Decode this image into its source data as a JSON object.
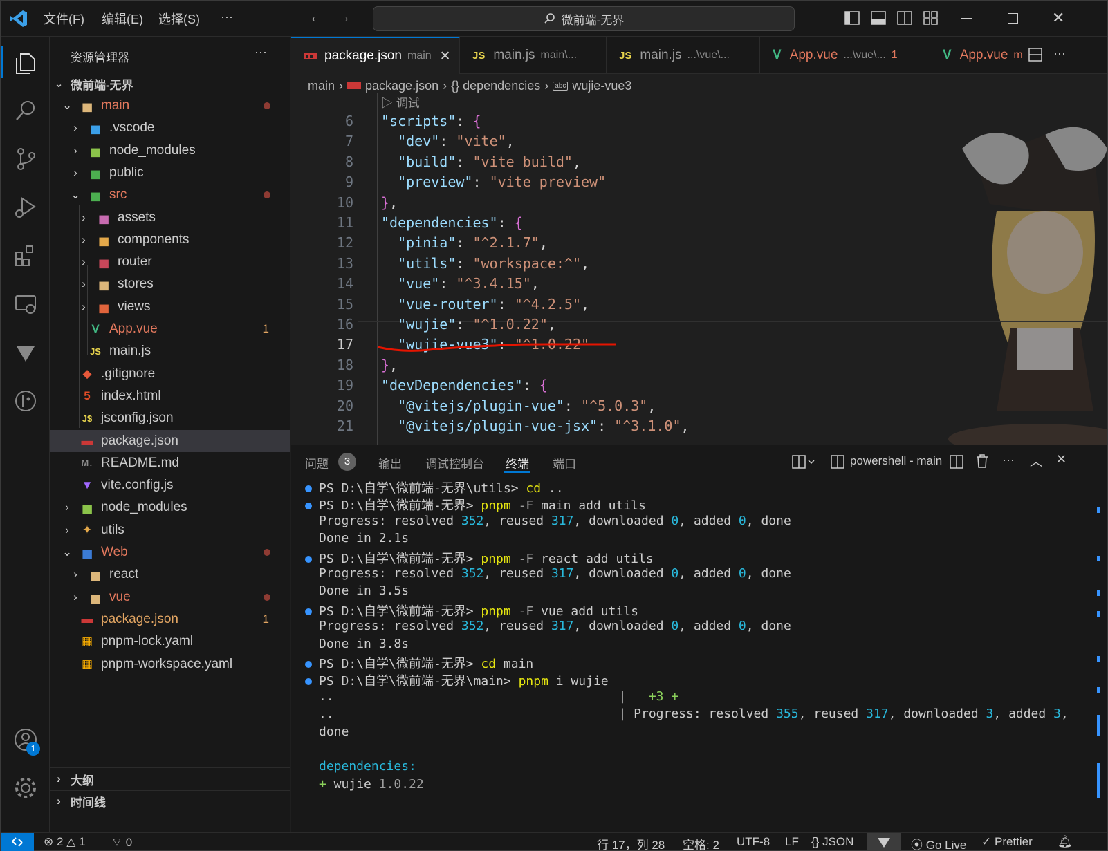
{
  "titlebar": {
    "menu": [
      "文件(F)",
      "编辑(E)",
      "选择(S)",
      "···"
    ],
    "search_text": "微前端-无界"
  },
  "sidebar": {
    "title": "资源管理器",
    "more": "···",
    "root": "微前端-无界",
    "items": [
      {
        "label": "main",
        "color": "#e2785d",
        "icon": "folder-open-icon",
        "badge": "dot"
      },
      {
        "label": ".vscode",
        "color": "#cccccc",
        "icon": "vscode-folder-icon"
      },
      {
        "label": "node_modules",
        "color": "#cccccc",
        "icon": "node-folder-icon"
      },
      {
        "label": "public",
        "color": "#cccccc",
        "icon": "public-folder-icon"
      },
      {
        "label": "src",
        "color": "#e2785d",
        "icon": "src-folder-icon",
        "badge": "dot"
      },
      {
        "label": "assets",
        "color": "#cccccc",
        "icon": "assets-folder-icon"
      },
      {
        "label": "components",
        "color": "#cccccc",
        "icon": "components-folder-icon"
      },
      {
        "label": "router",
        "color": "#cccccc",
        "icon": "router-folder-icon"
      },
      {
        "label": "stores",
        "color": "#cccccc",
        "icon": "folder-icon"
      },
      {
        "label": "views",
        "color": "#cccccc",
        "icon": "views-folder-icon"
      },
      {
        "label": "App.vue",
        "color": "#e2785d",
        "icon": "vue-file-icon",
        "count": "1"
      },
      {
        "label": "main.js",
        "color": "#cccccc",
        "icon": "js-file-icon"
      },
      {
        "label": ".gitignore",
        "color": "#cccccc",
        "icon": "git-file-icon"
      },
      {
        "label": "index.html",
        "color": "#cccccc",
        "icon": "html-file-icon"
      },
      {
        "label": "jsconfig.json",
        "color": "#cccccc",
        "icon": "jsconfig-file-icon"
      },
      {
        "label": "package.json",
        "color": "#cccccc",
        "icon": "npm-file-icon"
      },
      {
        "label": "README.md",
        "color": "#cccccc",
        "icon": "markdown-file-icon"
      },
      {
        "label": "vite.config.js",
        "color": "#cccccc",
        "icon": "vite-file-icon"
      },
      {
        "label": "node_modules",
        "color": "#cccccc",
        "icon": "node-folder-icon"
      },
      {
        "label": "utils",
        "color": "#cccccc",
        "icon": "utils-folder-icon"
      },
      {
        "label": "Web",
        "color": "#e2785d",
        "icon": "web-folder-icon",
        "badge": "dot"
      },
      {
        "label": "react",
        "color": "#cccccc",
        "icon": "folder-icon"
      },
      {
        "label": "vue",
        "color": "#e2785d",
        "icon": "folder-icon",
        "badge": "dot"
      },
      {
        "label": "package.json",
        "color": "#e3a663",
        "icon": "npm-file-icon",
        "count": "1"
      },
      {
        "label": "pnpm-lock.yaml",
        "color": "#cccccc",
        "icon": "pnpm-file-icon"
      },
      {
        "label": "pnpm-workspace.yaml",
        "color": "#cccccc",
        "icon": "pnpm-file-icon"
      }
    ],
    "outline": "大纲",
    "timeline": "时间线"
  },
  "tabs": [
    {
      "label": "package.json",
      "desc": "main",
      "active": true
    },
    {
      "label": "main.js",
      "desc": "main\\..."
    },
    {
      "label": "main.js",
      "desc": "...\\vue\\..."
    },
    {
      "label": "App.vue",
      "desc": "...\\vue\\...",
      "count": "1"
    },
    {
      "label": "App.vue",
      "desc": "m"
    }
  ],
  "breadcrumb": [
    "main",
    "package.json",
    "{} dependencies",
    "wujie-vue3"
  ],
  "codelens": "调试",
  "code_lines": [
    {
      "n": "6",
      "t": [
        [
          "k",
          "\"scripts\""
        ],
        [
          "p",
          ": "
        ],
        [
          "b1",
          "{"
        ]
      ]
    },
    {
      "n": "7",
      "t": [
        [
          "p",
          "  "
        ],
        [
          "k",
          "\"dev\""
        ],
        [
          "p",
          ": "
        ],
        [
          "s",
          "\"vite\""
        ],
        [
          "p",
          ","
        ]
      ]
    },
    {
      "n": "8",
      "t": [
        [
          "p",
          "  "
        ],
        [
          "k",
          "\"build\""
        ],
        [
          "p",
          ": "
        ],
        [
          "s",
          "\"vite build\""
        ],
        [
          "p",
          ","
        ]
      ]
    },
    {
      "n": "9",
      "t": [
        [
          "p",
          "  "
        ],
        [
          "k",
          "\"preview\""
        ],
        [
          "p",
          ": "
        ],
        [
          "s",
          "\"vite preview\""
        ]
      ]
    },
    {
      "n": "10",
      "t": [
        [
          "b1",
          "}"
        ],
        [
          "p",
          ","
        ]
      ]
    },
    {
      "n": "11",
      "t": [
        [
          "k",
          "\"dependencies\""
        ],
        [
          "p",
          ": "
        ],
        [
          "b1",
          "{"
        ]
      ]
    },
    {
      "n": "12",
      "t": [
        [
          "p",
          "  "
        ],
        [
          "k",
          "\"pinia\""
        ],
        [
          "p",
          ": "
        ],
        [
          "s",
          "\"^2.1.7\""
        ],
        [
          "p",
          ","
        ]
      ]
    },
    {
      "n": "13",
      "t": [
        [
          "p",
          "  "
        ],
        [
          "k",
          "\"utils\""
        ],
        [
          "p",
          ": "
        ],
        [
          "s",
          "\"workspace:^\""
        ],
        [
          "p",
          ","
        ]
      ]
    },
    {
      "n": "14",
      "t": [
        [
          "p",
          "  "
        ],
        [
          "k",
          "\"vue\""
        ],
        [
          "p",
          ": "
        ],
        [
          "s",
          "\"^3.4.15\""
        ],
        [
          "p",
          ","
        ]
      ]
    },
    {
      "n": "15",
      "t": [
        [
          "p",
          "  "
        ],
        [
          "k",
          "\"vue-router\""
        ],
        [
          "p",
          ": "
        ],
        [
          "s",
          "\"^4.2.5\""
        ],
        [
          "p",
          ","
        ]
      ]
    },
    {
      "n": "16",
      "t": [
        [
          "p",
          "  "
        ],
        [
          "k",
          "\"wujie\""
        ],
        [
          "p",
          ": "
        ],
        [
          "s",
          "\"^1.0.22\""
        ],
        [
          "p",
          ","
        ]
      ]
    },
    {
      "n": "17",
      "t": [
        [
          "p",
          "  "
        ],
        [
          "k",
          "\"wujie-vue3\""
        ],
        [
          "p",
          ": "
        ],
        [
          "s",
          "\"^1.0.22\""
        ]
      ]
    },
    {
      "n": "18",
      "t": [
        [
          "b1",
          "}"
        ],
        [
          "p",
          ","
        ]
      ]
    },
    {
      "n": "19",
      "t": [
        [
          "k",
          "\"devDependencies\""
        ],
        [
          "p",
          ": "
        ],
        [
          "b1",
          "{"
        ]
      ]
    },
    {
      "n": "20",
      "t": [
        [
          "p",
          "  "
        ],
        [
          "k",
          "\"@vitejs/plugin-vue\""
        ],
        [
          "p",
          ": "
        ],
        [
          "s",
          "\"^5.0.3\""
        ],
        [
          "p",
          ","
        ]
      ]
    },
    {
      "n": "21",
      "t": [
        [
          "p",
          "  "
        ],
        [
          "k",
          "\"@vitejs/plugin-vue-jsx\""
        ],
        [
          "p",
          ": "
        ],
        [
          "s",
          "\"^3.1.0\""
        ],
        [
          "p",
          ","
        ]
      ]
    }
  ],
  "panel": {
    "tabs": [
      "问题",
      "输出",
      "调试控制台",
      "终端",
      "端口"
    ],
    "problems_count": "3",
    "terminal_name": "powershell - main"
  },
  "terminal": [
    {
      "b": true,
      "t": [
        [
          "",
          "PS D:\\自学\\微前端-无界\\utils> "
        ],
        [
          "y",
          "cd"
        ],
        [
          "",
          " .."
        ]
      ]
    },
    {
      "b": true,
      "t": [
        [
          "",
          "PS D:\\自学\\微前端-无界> "
        ],
        [
          "y",
          "pnpm"
        ],
        [
          "gr",
          " -F"
        ],
        [
          "",
          " main add utils"
        ]
      ]
    },
    {
      "b": false,
      "t": [
        [
          "",
          "Progress: resolved "
        ],
        [
          "c",
          "352"
        ],
        [
          "",
          ", reused "
        ],
        [
          "c",
          "317"
        ],
        [
          "",
          ", downloaded "
        ],
        [
          "c",
          "0"
        ],
        [
          "",
          ", added "
        ],
        [
          "c",
          "0"
        ],
        [
          "",
          ", done"
        ]
      ]
    },
    {
      "b": false,
      "t": [
        [
          "",
          "Done in 2.1s"
        ]
      ]
    },
    {
      "b": true,
      "t": [
        [
          "",
          "PS D:\\自学\\微前端-无界> "
        ],
        [
          "y",
          "pnpm"
        ],
        [
          "gr",
          " -F"
        ],
        [
          "",
          " react add utils"
        ]
      ]
    },
    {
      "b": false,
      "t": [
        [
          "",
          "Progress: resolved "
        ],
        [
          "c",
          "352"
        ],
        [
          "",
          ", reused "
        ],
        [
          "c",
          "317"
        ],
        [
          "",
          ", downloaded "
        ],
        [
          "c",
          "0"
        ],
        [
          "",
          ", added "
        ],
        [
          "c",
          "0"
        ],
        [
          "",
          ", done"
        ]
      ]
    },
    {
      "b": false,
      "t": [
        [
          "",
          "Done in 3.5s"
        ]
      ]
    },
    {
      "b": true,
      "t": [
        [
          "",
          "PS D:\\自学\\微前端-无界> "
        ],
        [
          "y",
          "pnpm"
        ],
        [
          "gr",
          " -F"
        ],
        [
          "",
          " vue add utils"
        ]
      ]
    },
    {
      "b": false,
      "t": [
        [
          "",
          "Progress: resolved "
        ],
        [
          "c",
          "352"
        ],
        [
          "",
          ", reused "
        ],
        [
          "c",
          "317"
        ],
        [
          "",
          ", downloaded "
        ],
        [
          "c",
          "0"
        ],
        [
          "",
          ", added "
        ],
        [
          "c",
          "0"
        ],
        [
          "",
          ", done"
        ]
      ]
    },
    {
      "b": false,
      "t": [
        [
          "",
          "Done in 3.8s"
        ]
      ]
    },
    {
      "b": true,
      "t": [
        [
          "",
          "PS D:\\自学\\微前端-无界> "
        ],
        [
          "y",
          "cd"
        ],
        [
          "",
          " main"
        ]
      ]
    },
    {
      "b": true,
      "t": [
        [
          "",
          "PS D:\\自学\\微前端-无界\\main> "
        ],
        [
          "y",
          "pnpm"
        ],
        [
          "",
          " i wujie"
        ]
      ]
    },
    {
      "b": false,
      "t": [
        [
          "",
          "..                                      |   "
        ],
        [
          "g",
          "+3 +"
        ]
      ]
    },
    {
      "b": false,
      "t": [
        [
          "",
          "..                                      | Progress: resolved "
        ],
        [
          "c",
          "355"
        ],
        [
          "",
          ", reused "
        ],
        [
          "c",
          "317"
        ],
        [
          "",
          ", downloaded "
        ],
        [
          "c",
          "3"
        ],
        [
          "",
          ", added "
        ],
        [
          "c",
          "3"
        ],
        [
          "",
          ","
        ]
      ]
    },
    {
      "b": false,
      "t": [
        [
          "",
          "done"
        ]
      ]
    },
    {
      "b": false,
      "t": [
        [
          "",
          ""
        ]
      ]
    },
    {
      "b": false,
      "t": [
        [
          "c",
          "dependencies:"
        ]
      ]
    },
    {
      "b": false,
      "t": [
        [
          "g",
          "+"
        ],
        [
          "",
          " wujie "
        ],
        [
          "gr",
          "1.0.22"
        ]
      ]
    }
  ],
  "status": {
    "errors": "2",
    "warnings": "1",
    "ports": "0",
    "position": "行 17，列 28",
    "spaces": "空格: 2",
    "encoding": "UTF-8",
    "eol": "LF",
    "language": "{} JSON",
    "golive": "Go Live",
    "prettier": "Prettier"
  },
  "accounts_badge": "1",
  "colors": {
    "accent": "#0078d4",
    "orange": "#e2785d",
    "blue": "#3794ff",
    "annotation": "#e51400"
  }
}
